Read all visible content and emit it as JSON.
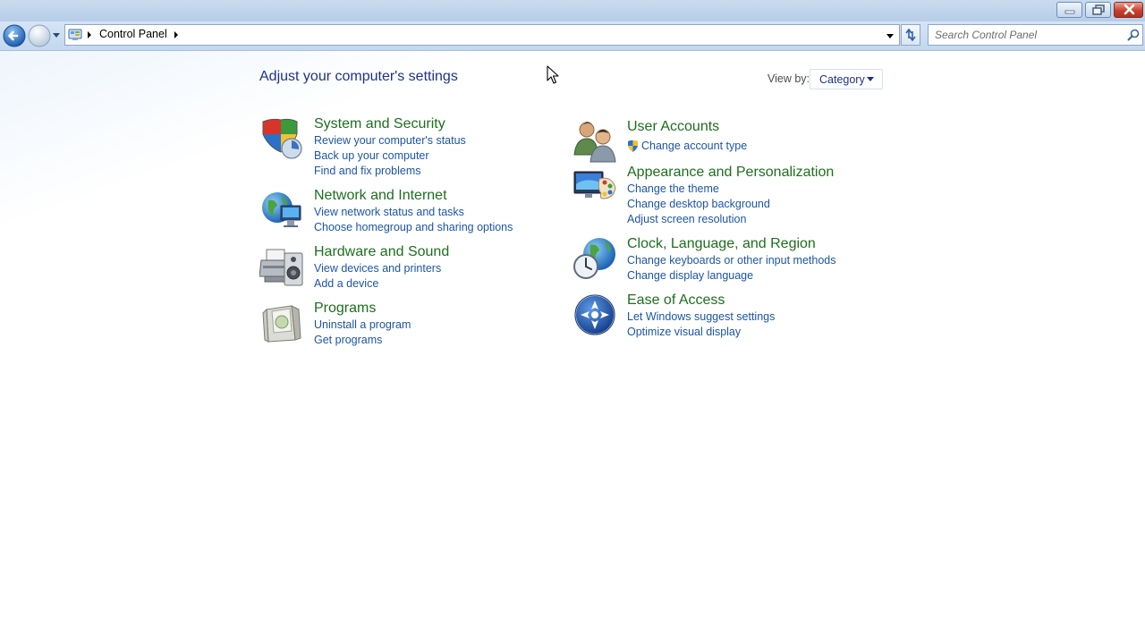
{
  "window": {
    "minimize_label": "Minimize",
    "maximize_label": "Restore Down",
    "close_label": "Close"
  },
  "navigation": {
    "breadcrumb": "Control Panel",
    "search_placeholder": "Search Control Panel"
  },
  "main": {
    "title": "Adjust your computer's settings",
    "view_by_label": "View by:",
    "view_by_value": "Category",
    "categories": [
      {
        "title": "System and Security",
        "icon": "shield-icon",
        "links": [
          "Review your computer's status",
          "Back up your computer",
          "Find and fix problems"
        ]
      },
      {
        "title": "Network and Internet",
        "icon": "network-globe-icon",
        "links": [
          "View network status and tasks",
          "Choose homegroup and sharing options"
        ]
      },
      {
        "title": "Hardware and Sound",
        "icon": "printer-speaker-icon",
        "links": [
          "View devices and printers",
          "Add a device"
        ]
      },
      {
        "title": "Programs",
        "icon": "programs-box-icon",
        "links": [
          "Uninstall a program",
          "Get programs"
        ]
      },
      {
        "title": "User Accounts",
        "icon": "users-icon",
        "links": [
          "Change account type"
        ]
      },
      {
        "title": "Appearance and Personalization",
        "icon": "monitor-palette-icon",
        "links": [
          "Change the theme",
          "Change desktop background",
          "Adjust screen resolution"
        ]
      },
      {
        "title": "Clock, Language, and Region",
        "icon": "clock-globe-icon",
        "links": [
          "Change keyboards or other input methods",
          "Change display language"
        ]
      },
      {
        "title": "Ease of Access",
        "icon": "ease-of-access-icon",
        "links": [
          "Let Windows suggest settings",
          "Optimize visual display"
        ]
      }
    ]
  },
  "colors": {
    "title_blue": "#1e3287",
    "category_green": "#1e6e1e",
    "link_blue": "#1c55a6"
  }
}
